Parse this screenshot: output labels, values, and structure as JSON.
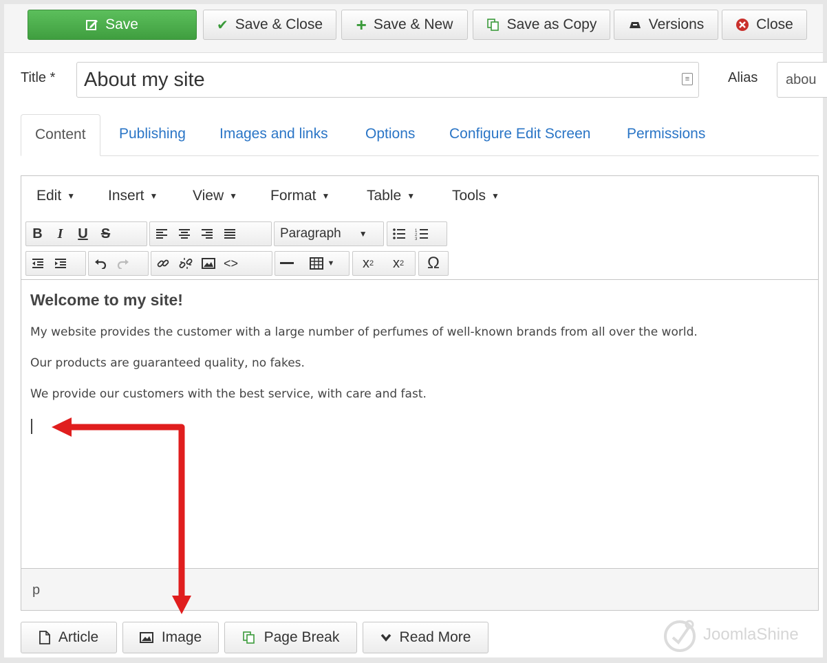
{
  "toolbar": {
    "save": "Save",
    "save_close": "Save & Close",
    "save_new": "Save & New",
    "save_copy": "Save as Copy",
    "versions": "Versions",
    "close": "Close"
  },
  "title_field": {
    "label": "Title *",
    "value": "About my site"
  },
  "alias_field": {
    "label": "Alias",
    "value": "abou"
  },
  "tabs": [
    "Content",
    "Publishing",
    "Images and links",
    "Options",
    "Configure Edit Screen",
    "Permissions"
  ],
  "editor": {
    "menus": [
      "Edit",
      "Insert",
      "View",
      "Format",
      "Table",
      "Tools"
    ],
    "format_select": "Paragraph",
    "content": {
      "heading": "Welcome to my site!",
      "paragraphs": [
        "My website provides the customer with a large number of perfumes of well-known brands from all over the world.",
        "Our products are guaranteed quality, no fakes.",
        "We provide our customers with the best service, with care and fast."
      ]
    },
    "status_path": "p"
  },
  "bottom_buttons": {
    "article": "Article",
    "image": "Image",
    "page_break": "Page Break",
    "read_more": "Read More"
  },
  "logo": {
    "text": "JoomlaShine"
  },
  "colors": {
    "save_green": "#4cae4c",
    "link_blue": "#2a75c6",
    "arrow_red": "#e01e1e"
  }
}
